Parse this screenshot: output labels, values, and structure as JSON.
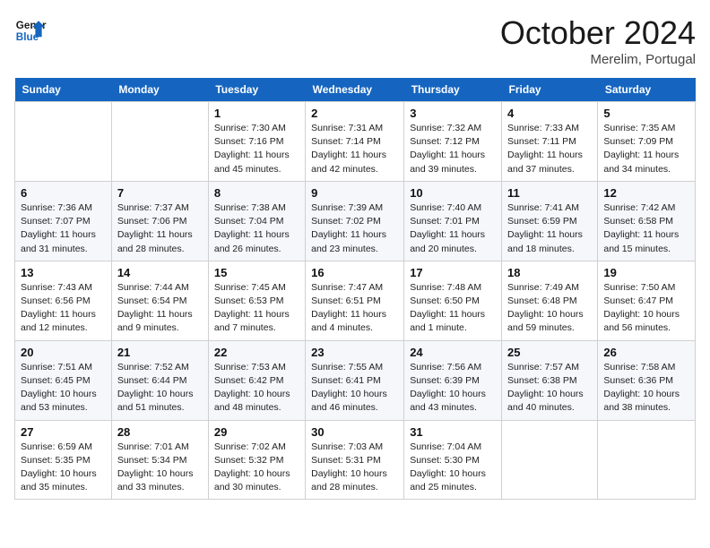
{
  "header": {
    "logo_line1": "General",
    "logo_line2": "Blue",
    "month_title": "October 2024",
    "location": "Merelim, Portugal"
  },
  "weekdays": [
    "Sunday",
    "Monday",
    "Tuesday",
    "Wednesday",
    "Thursday",
    "Friday",
    "Saturday"
  ],
  "weeks": [
    [
      {
        "day": "",
        "sunrise": "",
        "sunset": "",
        "daylight": ""
      },
      {
        "day": "",
        "sunrise": "",
        "sunset": "",
        "daylight": ""
      },
      {
        "day": "1",
        "sunrise": "Sunrise: 7:30 AM",
        "sunset": "Sunset: 7:16 PM",
        "daylight": "Daylight: 11 hours and 45 minutes."
      },
      {
        "day": "2",
        "sunrise": "Sunrise: 7:31 AM",
        "sunset": "Sunset: 7:14 PM",
        "daylight": "Daylight: 11 hours and 42 minutes."
      },
      {
        "day": "3",
        "sunrise": "Sunrise: 7:32 AM",
        "sunset": "Sunset: 7:12 PM",
        "daylight": "Daylight: 11 hours and 39 minutes."
      },
      {
        "day": "4",
        "sunrise": "Sunrise: 7:33 AM",
        "sunset": "Sunset: 7:11 PM",
        "daylight": "Daylight: 11 hours and 37 minutes."
      },
      {
        "day": "5",
        "sunrise": "Sunrise: 7:35 AM",
        "sunset": "Sunset: 7:09 PM",
        "daylight": "Daylight: 11 hours and 34 minutes."
      }
    ],
    [
      {
        "day": "6",
        "sunrise": "Sunrise: 7:36 AM",
        "sunset": "Sunset: 7:07 PM",
        "daylight": "Daylight: 11 hours and 31 minutes."
      },
      {
        "day": "7",
        "sunrise": "Sunrise: 7:37 AM",
        "sunset": "Sunset: 7:06 PM",
        "daylight": "Daylight: 11 hours and 28 minutes."
      },
      {
        "day": "8",
        "sunrise": "Sunrise: 7:38 AM",
        "sunset": "Sunset: 7:04 PM",
        "daylight": "Daylight: 11 hours and 26 minutes."
      },
      {
        "day": "9",
        "sunrise": "Sunrise: 7:39 AM",
        "sunset": "Sunset: 7:02 PM",
        "daylight": "Daylight: 11 hours and 23 minutes."
      },
      {
        "day": "10",
        "sunrise": "Sunrise: 7:40 AM",
        "sunset": "Sunset: 7:01 PM",
        "daylight": "Daylight: 11 hours and 20 minutes."
      },
      {
        "day": "11",
        "sunrise": "Sunrise: 7:41 AM",
        "sunset": "Sunset: 6:59 PM",
        "daylight": "Daylight: 11 hours and 18 minutes."
      },
      {
        "day": "12",
        "sunrise": "Sunrise: 7:42 AM",
        "sunset": "Sunset: 6:58 PM",
        "daylight": "Daylight: 11 hours and 15 minutes."
      }
    ],
    [
      {
        "day": "13",
        "sunrise": "Sunrise: 7:43 AM",
        "sunset": "Sunset: 6:56 PM",
        "daylight": "Daylight: 11 hours and 12 minutes."
      },
      {
        "day": "14",
        "sunrise": "Sunrise: 7:44 AM",
        "sunset": "Sunset: 6:54 PM",
        "daylight": "Daylight: 11 hours and 9 minutes."
      },
      {
        "day": "15",
        "sunrise": "Sunrise: 7:45 AM",
        "sunset": "Sunset: 6:53 PM",
        "daylight": "Daylight: 11 hours and 7 minutes."
      },
      {
        "day": "16",
        "sunrise": "Sunrise: 7:47 AM",
        "sunset": "Sunset: 6:51 PM",
        "daylight": "Daylight: 11 hours and 4 minutes."
      },
      {
        "day": "17",
        "sunrise": "Sunrise: 7:48 AM",
        "sunset": "Sunset: 6:50 PM",
        "daylight": "Daylight: 11 hours and 1 minute."
      },
      {
        "day": "18",
        "sunrise": "Sunrise: 7:49 AM",
        "sunset": "Sunset: 6:48 PM",
        "daylight": "Daylight: 10 hours and 59 minutes."
      },
      {
        "day": "19",
        "sunrise": "Sunrise: 7:50 AM",
        "sunset": "Sunset: 6:47 PM",
        "daylight": "Daylight: 10 hours and 56 minutes."
      }
    ],
    [
      {
        "day": "20",
        "sunrise": "Sunrise: 7:51 AM",
        "sunset": "Sunset: 6:45 PM",
        "daylight": "Daylight: 10 hours and 53 minutes."
      },
      {
        "day": "21",
        "sunrise": "Sunrise: 7:52 AM",
        "sunset": "Sunset: 6:44 PM",
        "daylight": "Daylight: 10 hours and 51 minutes."
      },
      {
        "day": "22",
        "sunrise": "Sunrise: 7:53 AM",
        "sunset": "Sunset: 6:42 PM",
        "daylight": "Daylight: 10 hours and 48 minutes."
      },
      {
        "day": "23",
        "sunrise": "Sunrise: 7:55 AM",
        "sunset": "Sunset: 6:41 PM",
        "daylight": "Daylight: 10 hours and 46 minutes."
      },
      {
        "day": "24",
        "sunrise": "Sunrise: 7:56 AM",
        "sunset": "Sunset: 6:39 PM",
        "daylight": "Daylight: 10 hours and 43 minutes."
      },
      {
        "day": "25",
        "sunrise": "Sunrise: 7:57 AM",
        "sunset": "Sunset: 6:38 PM",
        "daylight": "Daylight: 10 hours and 40 minutes."
      },
      {
        "day": "26",
        "sunrise": "Sunrise: 7:58 AM",
        "sunset": "Sunset: 6:36 PM",
        "daylight": "Daylight: 10 hours and 38 minutes."
      }
    ],
    [
      {
        "day": "27",
        "sunrise": "Sunrise: 6:59 AM",
        "sunset": "Sunset: 5:35 PM",
        "daylight": "Daylight: 10 hours and 35 minutes."
      },
      {
        "day": "28",
        "sunrise": "Sunrise: 7:01 AM",
        "sunset": "Sunset: 5:34 PM",
        "daylight": "Daylight: 10 hours and 33 minutes."
      },
      {
        "day": "29",
        "sunrise": "Sunrise: 7:02 AM",
        "sunset": "Sunset: 5:32 PM",
        "daylight": "Daylight: 10 hours and 30 minutes."
      },
      {
        "day": "30",
        "sunrise": "Sunrise: 7:03 AM",
        "sunset": "Sunset: 5:31 PM",
        "daylight": "Daylight: 10 hours and 28 minutes."
      },
      {
        "day": "31",
        "sunrise": "Sunrise: 7:04 AM",
        "sunset": "Sunset: 5:30 PM",
        "daylight": "Daylight: 10 hours and 25 minutes."
      },
      {
        "day": "",
        "sunrise": "",
        "sunset": "",
        "daylight": ""
      },
      {
        "day": "",
        "sunrise": "",
        "sunset": "",
        "daylight": ""
      }
    ]
  ]
}
